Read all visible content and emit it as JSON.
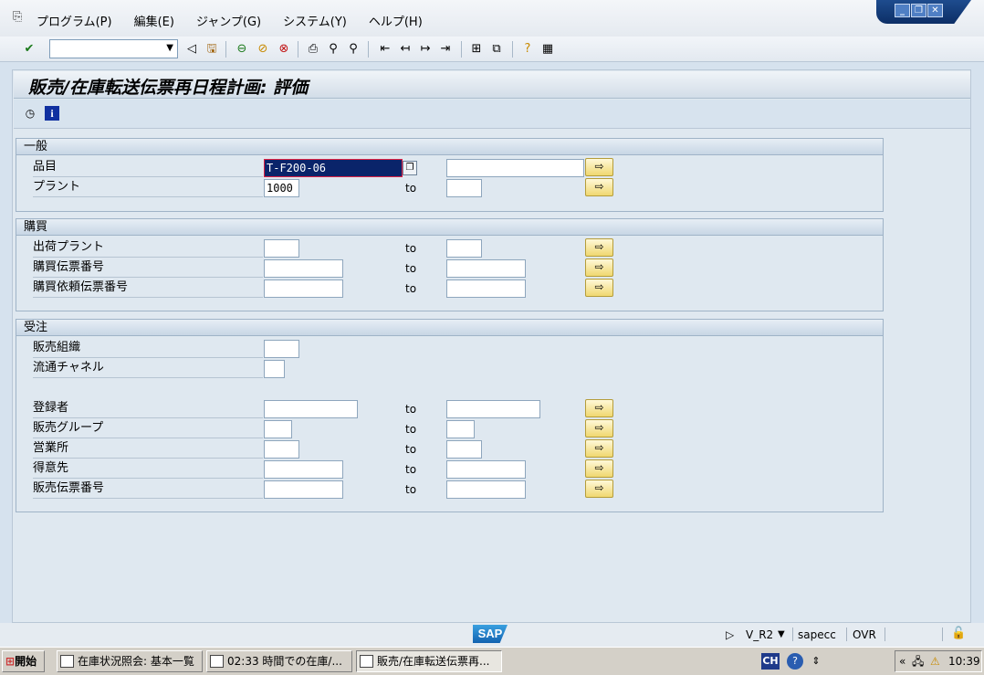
{
  "menu": {
    "items": [
      "プログラム(P)",
      "編集(E)",
      "ジャンプ(G)",
      "システム(Y)",
      "ヘルプ(H)"
    ]
  },
  "window_controls": {
    "minimize": "_",
    "restore": "❐",
    "close": "✕"
  },
  "toolbar": {
    "command_field": {
      "value": ""
    }
  },
  "screen": {
    "title": "販売/在庫転送伝票再日程計画: 評価"
  },
  "groups": {
    "general": {
      "title": "一般",
      "material": {
        "label": "品目",
        "value": "T-F200-06",
        "to_value": ""
      },
      "plant": {
        "label": "プラント",
        "value": "1000",
        "to_label": "to",
        "to_value": ""
      }
    },
    "purchasing": {
      "title": "購買",
      "ship_plant": {
        "label": "出荷プラント",
        "value": "",
        "to_label": "to",
        "to_value": ""
      },
      "po_number": {
        "label": "購買伝票番号",
        "value": "",
        "to_label": "to",
        "to_value": ""
      },
      "pr_number": {
        "label": "購買依頼伝票番号",
        "value": "",
        "to_label": "to",
        "to_value": ""
      }
    },
    "sales": {
      "title": "受注",
      "sales_org": {
        "label": "販売組織",
        "value": ""
      },
      "dist_channel": {
        "label": "流通チャネル",
        "value": ""
      },
      "created_by": {
        "label": "登録者",
        "value": "",
        "to_label": "to",
        "to_value": ""
      },
      "sales_group": {
        "label": "販売グループ",
        "value": "",
        "to_label": "to",
        "to_value": ""
      },
      "sales_office": {
        "label": "営業所",
        "value": "",
        "to_label": "to",
        "to_value": ""
      },
      "customer": {
        "label": "得意先",
        "value": "",
        "to_label": "to",
        "to_value": ""
      },
      "sales_doc": {
        "label": "販売伝票番号",
        "value": "",
        "to_label": "to",
        "to_value": ""
      }
    }
  },
  "statusbar": {
    "logo": "SAP",
    "transaction": "V_R2",
    "server": "sapecc",
    "mode": "OVR"
  },
  "taskbar": {
    "start": "開始",
    "tasks": [
      "在庫状況照会: 基本一覧",
      "02:33 時間での在庫/...",
      "販売/在庫転送伝票再..."
    ],
    "lang": "CH",
    "clock": "10:39"
  }
}
